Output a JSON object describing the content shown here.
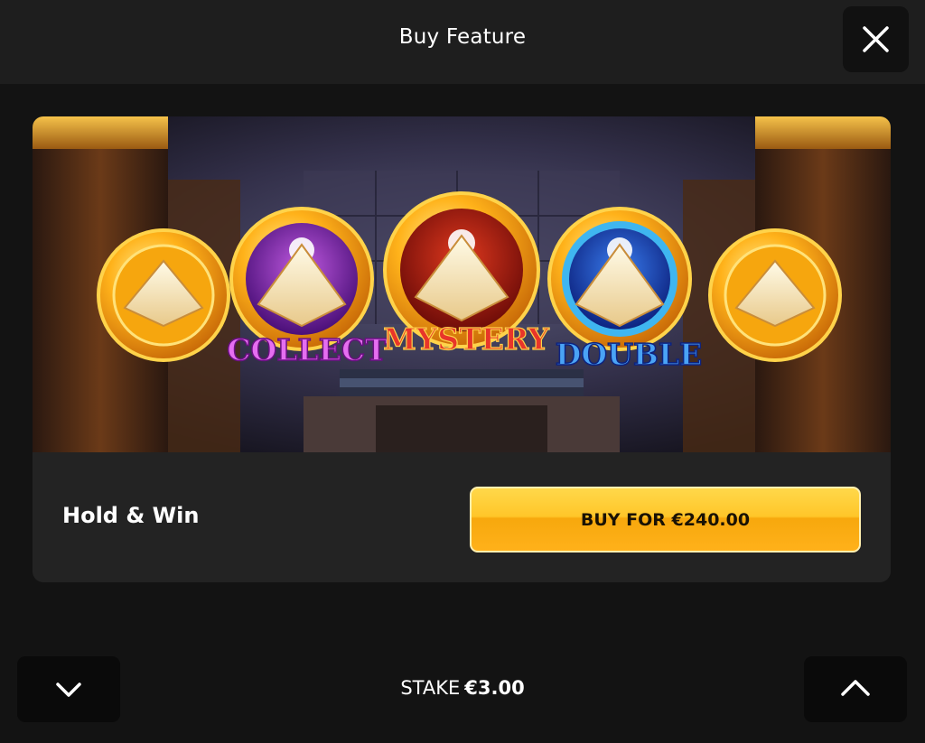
{
  "header": {
    "title": "Buy Feature",
    "close_icon": "close-icon"
  },
  "feature": {
    "name": "Hold & Win",
    "buy_label": "BUY FOR €240.00",
    "banner_words": {
      "collect": "COLLECT",
      "mystery": "MYSTERY",
      "double": "DOUBLE"
    }
  },
  "footer": {
    "stake_label": "STAKE",
    "stake_value": "€3.00",
    "decrease_icon": "chevron-down-icon",
    "increase_icon": "chevron-up-icon"
  },
  "colors": {
    "background": "#131313",
    "header": "#1e1e1e",
    "card": "#232323",
    "buy_button": "#ffc629",
    "collect": "#c23bd6",
    "mystery": "#e0261a",
    "double": "#2c7fe0"
  }
}
